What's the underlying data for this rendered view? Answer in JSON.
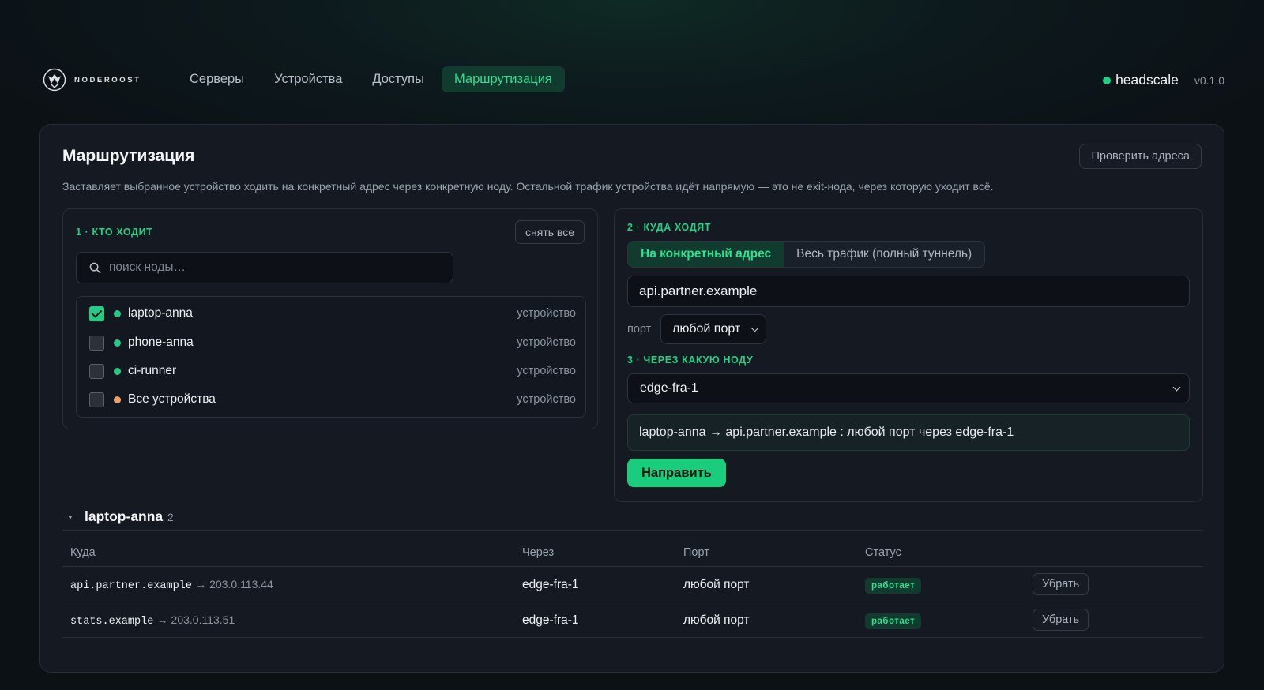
{
  "header": {
    "logo_text": "NODEROOST",
    "nav": [
      {
        "label": "Серверы"
      },
      {
        "label": "Устройства"
      },
      {
        "label": "Доступы"
      },
      {
        "label": "Маршрутизация",
        "active": true
      }
    ],
    "server_name": "headscale",
    "version": "v0.1.0",
    "status_color": "#1fd184"
  },
  "page": {
    "title": "Маршрутизация",
    "check_button": "Проверить адреса",
    "description": "Заставляет выбранное устройство ходить на конкретный адрес через конкретную ноду. Остальной трафик устройства идёт напрямую — это не exit-нода, через которую уходит всё."
  },
  "who": {
    "label": "1 · КТО ХОДИТ",
    "clear_button": "снять все",
    "search_placeholder": "поиск ноды…",
    "nodes": [
      {
        "name": "laptop-anna",
        "type": "устройство",
        "checked": true,
        "dot": "green"
      },
      {
        "name": "phone-anna",
        "type": "устройство",
        "checked": false,
        "dot": "green"
      },
      {
        "name": "ci-runner",
        "type": "устройство",
        "checked": false,
        "dot": "green"
      },
      {
        "name": "Все устройства",
        "type": "устройство",
        "checked": false,
        "dot": "orange"
      }
    ]
  },
  "where": {
    "label": "2 · КУДА ХОДЯТ",
    "tab_specific": "На конкретный адрес",
    "tab_full": "Весь трафик (полный туннель)",
    "address_value": "api.partner.example",
    "port_label": "порт",
    "port_value": "любой порт"
  },
  "via": {
    "label": "3 · ЧЕРЕЗ КАКУЮ НОДУ",
    "node_value": "edge-fra-1",
    "summary": "laptop-anna → api.partner.example : любой порт через edge-fra-1",
    "submit_button": "Направить"
  },
  "group": {
    "name": "laptop-anna",
    "count": "2"
  },
  "table": {
    "headers": {
      "dest": "Куда",
      "via": "Через",
      "port": "Порт",
      "status": "Статус"
    },
    "rows": [
      {
        "host": "api.partner.example",
        "ip": "→ 203.0.113.44",
        "via": "edge-fra-1",
        "port": "любой порт",
        "status": "работает",
        "action": "Убрать"
      },
      {
        "host": "stats.example",
        "ip": "→ 203.0.113.51",
        "via": "edge-fra-1",
        "port": "любой порт",
        "status": "работает",
        "action": "Убрать"
      }
    ]
  },
  "colors": {
    "accent": "#22d182",
    "background": "#0c1116",
    "card": "#151a22"
  }
}
